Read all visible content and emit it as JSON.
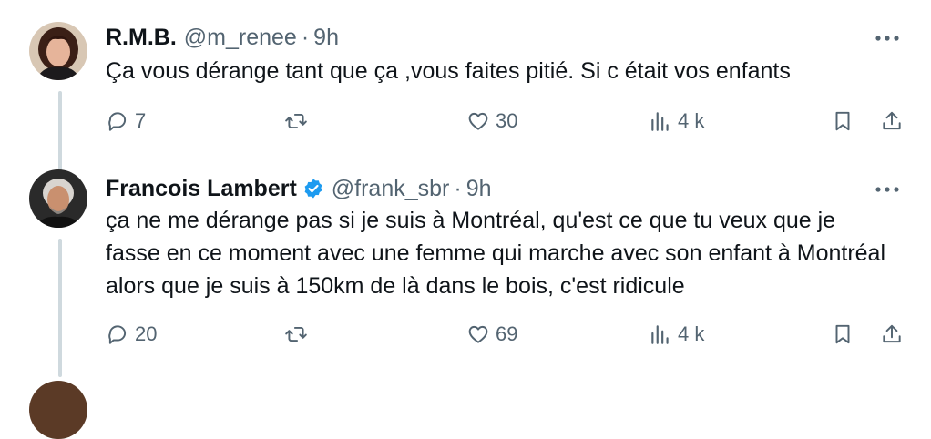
{
  "tweets": [
    {
      "name": "R.M.B.",
      "handle": "@m_renee",
      "separator": "·",
      "time": "9h",
      "text": "Ça vous dérange tant que ça ,vous faites pitié. Si c était vos enfants",
      "verified": false,
      "replies": "7",
      "retweets": "",
      "likes": "30",
      "views": "4 k"
    },
    {
      "name": "Francois Lambert",
      "handle": "@frank_sbr",
      "separator": "·",
      "time": "9h",
      "text": "ça ne me dérange pas si je suis à Montréal, qu'est ce que tu veux que je fasse en ce moment avec une femme qui marche avec son enfant à Montréal alors que je suis à 150km de là dans le bois, c'est ridicule",
      "verified": true,
      "replies": "20",
      "retweets": "",
      "likes": "69",
      "views": "4 k"
    }
  ],
  "colors": {
    "text": "#0f1419",
    "secondary": "#536471",
    "verified": "#1d9bf0",
    "thread_line": "#cfd9de"
  }
}
